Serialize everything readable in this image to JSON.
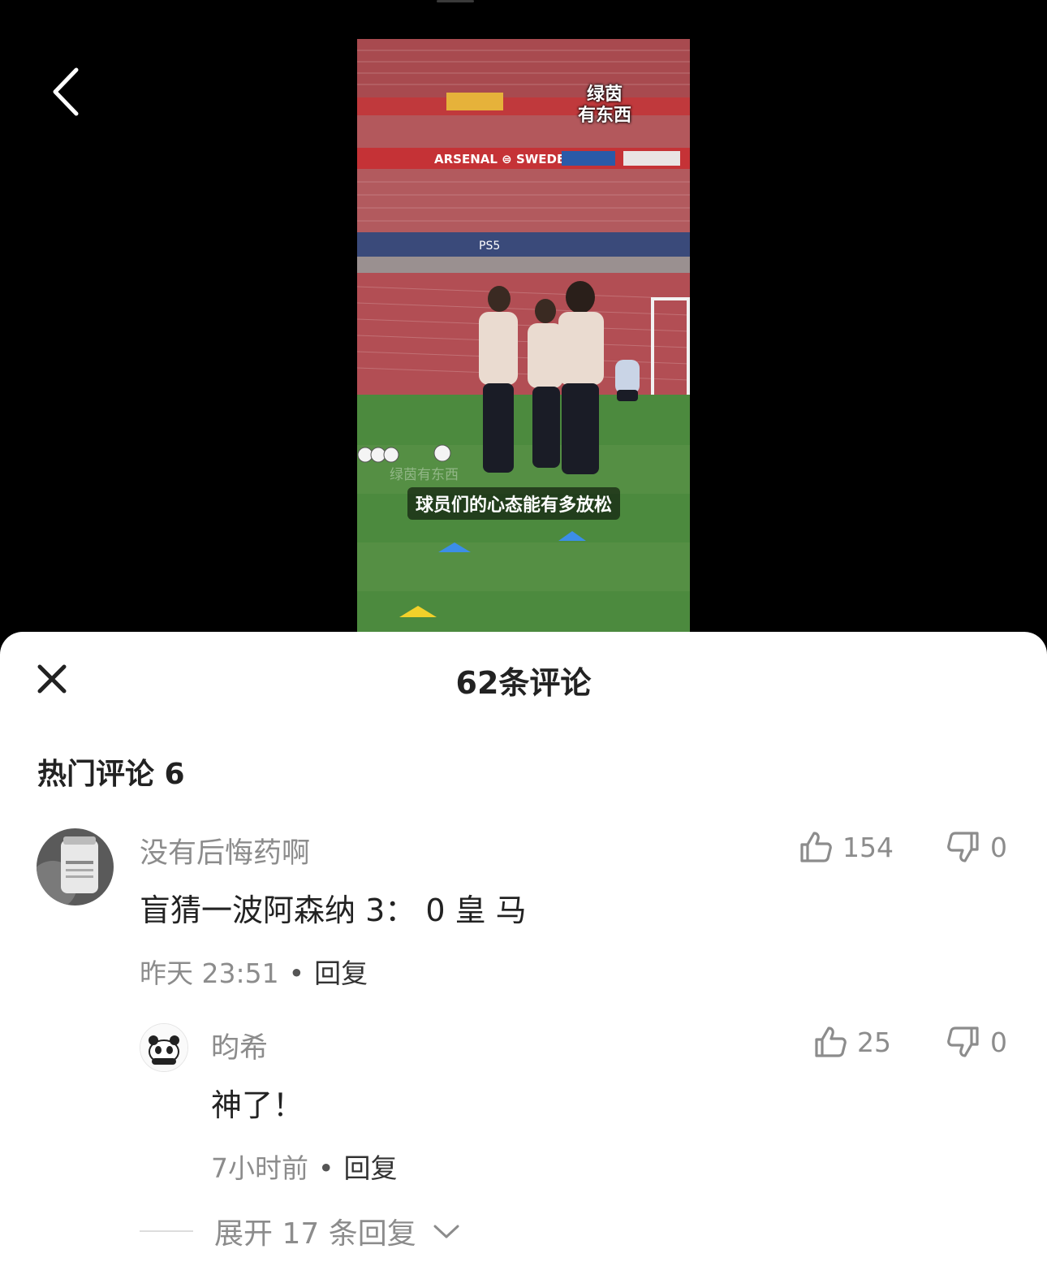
{
  "video": {
    "watermark_line1": "绿茵",
    "watermark_line2": "有东西",
    "watermark_faint": "绿茵有东西",
    "caption": "球员们的心态能有多放松",
    "stadium_banner": "ARSENAL ⊜ SWEDEN",
    "stand_sponsor": "PS5"
  },
  "sheet": {
    "title": "62条评论",
    "hot_section_title": "热门评论 6"
  },
  "comments": [
    {
      "username": "没有后悔药啊",
      "text": "盲猜一波阿森纳 3：  0 皇 马",
      "time": "昨天 23:51",
      "reply_label": "回复",
      "likes": "154",
      "dislikes": "0",
      "avatar_label": "后悔药"
    },
    {
      "username": "昀希",
      "text": "神了！",
      "time": "7小时前",
      "reply_label": "回复",
      "likes": "25",
      "dislikes": "0"
    }
  ],
  "expand_replies_label": "展开 17 条回复",
  "colors": {
    "sheet_bg": "#ffffff",
    "muted_text": "#8c8c8c",
    "primary_text": "#222222"
  }
}
